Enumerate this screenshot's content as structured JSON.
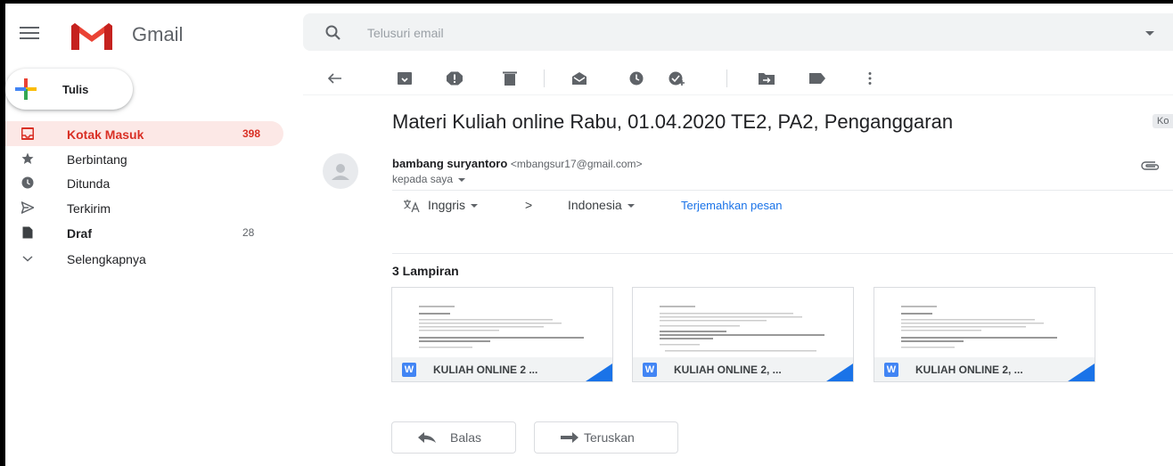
{
  "app": {
    "brand": "Gmail"
  },
  "search": {
    "placeholder": "Telusuri email"
  },
  "sidebar": {
    "compose_label": "Tulis",
    "items": [
      {
        "label": "Kotak Masuk",
        "count": "398",
        "icon": "inbox-icon",
        "active": true
      },
      {
        "label": "Berbintang",
        "count": "",
        "icon": "star-icon"
      },
      {
        "label": "Ditunda",
        "count": "",
        "icon": "clock-icon"
      },
      {
        "label": "Terkirim",
        "count": "",
        "icon": "send-icon"
      },
      {
        "label": "Draf",
        "count": "28",
        "icon": "draft-icon"
      },
      {
        "label": "Selengkapnya",
        "count": "",
        "icon": "chevron-down-icon"
      }
    ]
  },
  "toolbar": {
    "icons": [
      "back-arrow-icon",
      "archive-icon",
      "report-spam-icon",
      "delete-icon",
      "mark-unread-icon",
      "snooze-icon",
      "add-to-tasks-icon",
      "move-to-icon",
      "label-icon",
      "more-vert-icon"
    ]
  },
  "message": {
    "subject": "Materi Kuliah online Rabu, 01.04.2020 TE2, PA2, Penganggaran",
    "label_chip": "Ko",
    "sender_name": "bambang suryantoro",
    "sender_email": "<mbangsur17@gmail.com>",
    "recipient": "kepada saya"
  },
  "translate": {
    "from": "Inggris",
    "arrow": ">",
    "to": "Indonesia",
    "action": "Terjemahkan pesan"
  },
  "attachments": {
    "title": "3 Lampiran",
    "items": [
      {
        "name": "KULIAH ONLINE 2 ...",
        "type_letter": "W"
      },
      {
        "name": "KULIAH ONLINE 2, ...",
        "type_letter": "W"
      },
      {
        "name": "KULIAH ONLINE 2, ...",
        "type_letter": "W"
      }
    ]
  },
  "actions": {
    "reply": "Balas",
    "forward": "Teruskan"
  },
  "colors": {
    "accent_red": "#d93025",
    "active_bg": "#fce8e6",
    "link_blue": "#1a73e8"
  }
}
